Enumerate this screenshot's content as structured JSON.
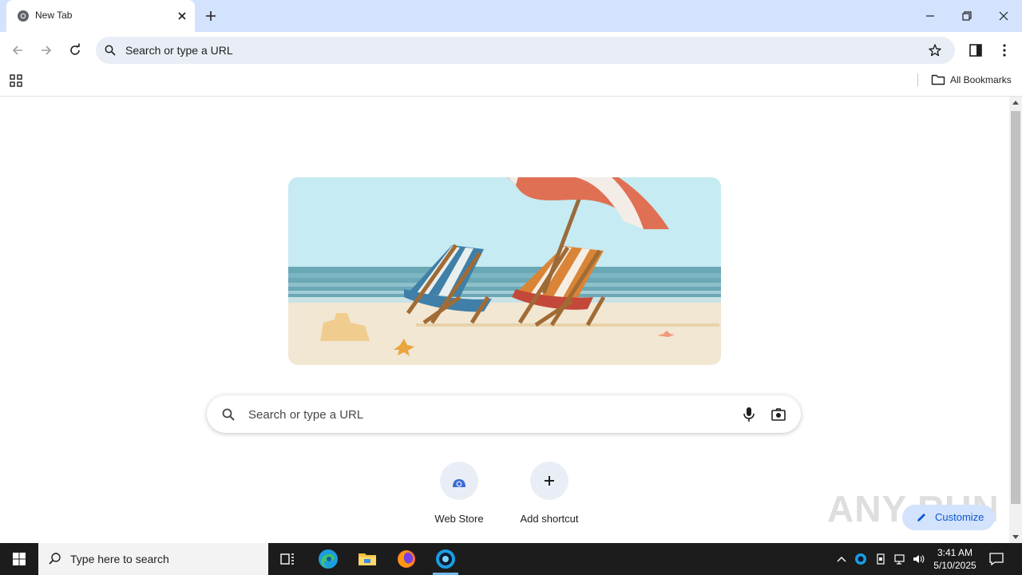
{
  "tab": {
    "title": "New Tab"
  },
  "omnibox": {
    "text": "Search or type a URL"
  },
  "bookmarks": {
    "all_label": "All Bookmarks"
  },
  "search": {
    "placeholder": "Search or type a URL"
  },
  "shortcuts": [
    {
      "label": "Web Store",
      "icon": "webstore-icon"
    },
    {
      "label": "Add shortcut",
      "icon": "plus-icon"
    }
  ],
  "customize": {
    "label": "Customize"
  },
  "watermark": {
    "text": "ANY RUN"
  },
  "taskbar": {
    "search_placeholder": "Type here to search",
    "time": "3:41 AM",
    "date": "5/10/2025"
  },
  "colors": {
    "titlebar": "#d3e3fd",
    "omnibox": "#e9eef6",
    "accent": "#0b57d0",
    "taskbar": "#1c1c1c"
  }
}
